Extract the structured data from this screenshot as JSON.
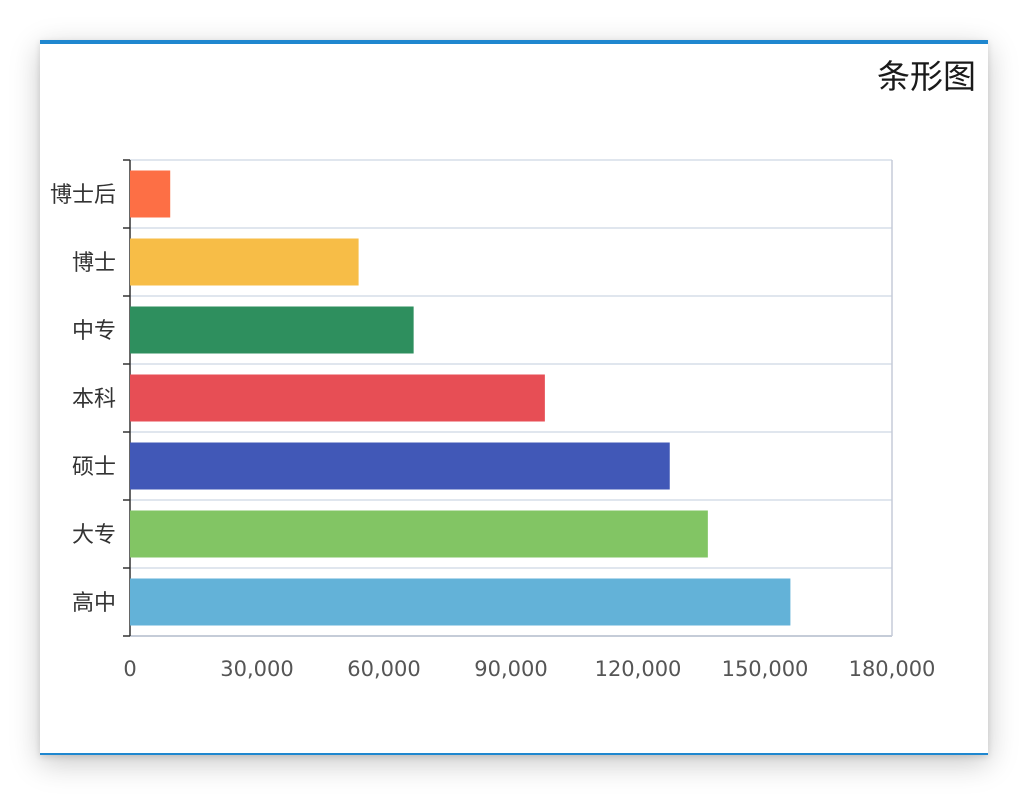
{
  "title": "条形图",
  "chart_data": {
    "type": "bar",
    "orientation": "horizontal",
    "title": "条形图",
    "categories": [
      "高中",
      "大专",
      "硕士",
      "本科",
      "中专",
      "博士",
      "博士后"
    ],
    "values": [
      156000,
      136500,
      127500,
      98000,
      67000,
      54000,
      9500
    ],
    "colors": [
      "#63b2d8",
      "#82c564",
      "#4158b7",
      "#e74e55",
      "#2e8f5e",
      "#f7bd47",
      "#fd6f45"
    ],
    "xlim": [
      0,
      180000
    ],
    "xticks": [
      "0",
      "30,000",
      "60,000",
      "90,000",
      "120,000",
      "150,000",
      "180,000"
    ],
    "grid": true,
    "xlabel": "",
    "ylabel": ""
  }
}
